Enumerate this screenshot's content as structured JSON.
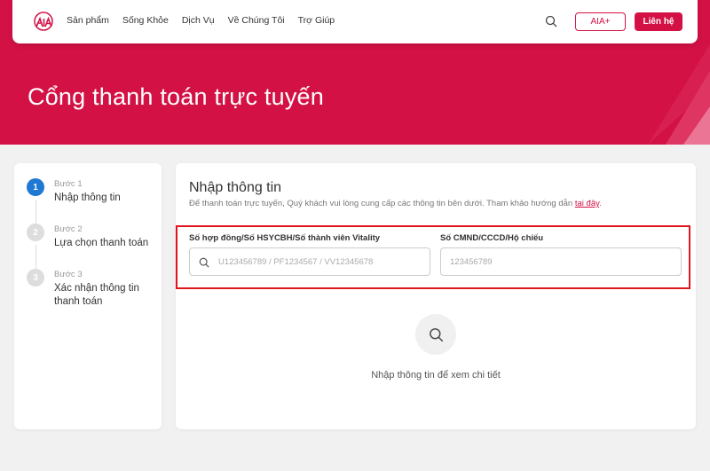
{
  "nav": {
    "items": [
      "Sản phẩm",
      "Sống Khỏe",
      "Dịch Vụ",
      "Về Chúng Tôi",
      "Trợ Giúp"
    ],
    "aia_plus": "AIA+",
    "contact": "Liên hệ"
  },
  "hero": {
    "title": "Cổng thanh toán trực tuyến"
  },
  "steps": [
    {
      "number": "1",
      "sub": "Bước 1",
      "title": "Nhập thông tin",
      "active": true
    },
    {
      "number": "2",
      "sub": "Bước 2",
      "title": "Lựa chọn thanh toán",
      "active": false
    },
    {
      "number": "3",
      "sub": "Bước 3",
      "title": "Xác nhận thông tin thanh toán",
      "active": false
    }
  ],
  "form": {
    "title": "Nhập thông tin",
    "description": "Để thanh toán trực tuyến, Quý khách vui lòng cung cấp các thông tin bên dưới. Tham khảo hướng dẫn ",
    "guide_link": "tại đây",
    "guide_suffix": ".",
    "contract_label": "Số hợp đồng/Số HSYCBH/Số thành viên Vitality",
    "contract_placeholder": "U123456789 / PF1234567 / VV12345678",
    "id_label": "Số CMND/CCCD/Hộ chiếu",
    "id_placeholder": "123456789"
  },
  "empty_state": {
    "message": "Nhập thông tin để xem chi tiết"
  },
  "colors": {
    "brand": "#d31145",
    "active_step": "#1f78d1",
    "highlight": "#e0161e"
  },
  "icons": {
    "logo": "aia-logo",
    "search": "search-icon"
  }
}
